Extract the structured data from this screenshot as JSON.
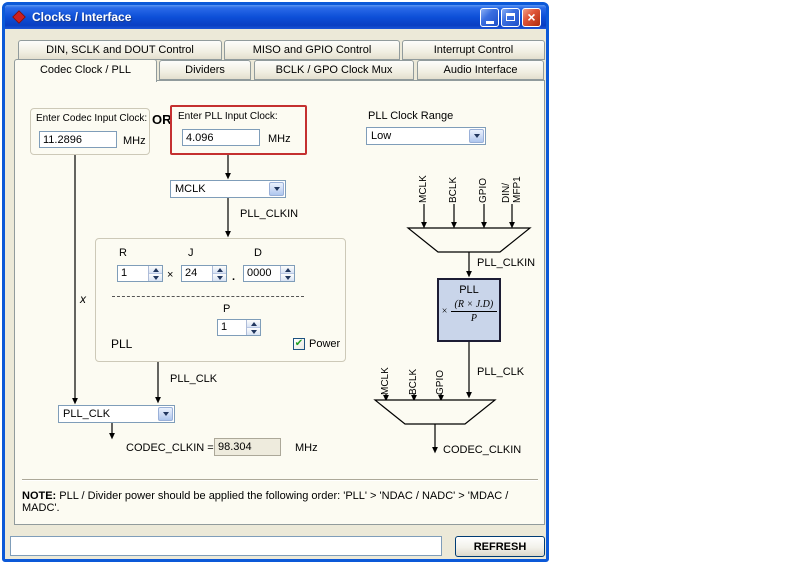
{
  "icons": {
    "close_glyph": "×",
    "check_glyph": "✔"
  },
  "title_bar": {
    "title": "Clocks / Interface"
  },
  "tabs_outer": [
    "DIN, SCLK and DOUT Control",
    "MISO and GPIO Control",
    "Interrupt Control"
  ],
  "tabs_inner": [
    "Codec Clock / PLL",
    "Dividers",
    "BCLK / GPO Clock Mux",
    "Audio Interface"
  ],
  "left": {
    "codec_group_label": "Enter Codec Input Clock:",
    "codec_value": "11.2896",
    "codec_unit": "MHz",
    "or_label": "OR",
    "pll_group_label": "Enter PLL Input Clock:",
    "pll_value": "4.096",
    "pll_unit": "MHz",
    "clkin_mux_value": "MCLK",
    "pll_clkin_arrow_label": "PLL_CLKIN",
    "x_operand": "x",
    "r_label": "R",
    "r_value": "1",
    "times_operand": "×",
    "j_label": "J",
    "j_value": "24",
    "dot_operand": ".",
    "d_label": "D",
    "d_value": "0000",
    "p_label": "P",
    "p_value": "1",
    "pll_caption": "PLL",
    "power_label": "Power",
    "pll_clk_arrow_label": "PLL_CLK",
    "pll_clk_mux_value": "PLL_CLK",
    "codec_clkin_label": "CODEC_CLKIN =",
    "codec_clkin_value": "98.304",
    "codec_clkin_unit": "MHz"
  },
  "right": {
    "range_label": "PLL Clock Range",
    "range_value": "Low",
    "mux1_inputs": [
      "MCLK",
      "BCLK",
      "GPIO",
      "DIN/\nMFP1"
    ],
    "pll_clkin_label": "PLL_CLKIN",
    "pll_box_title": "PLL",
    "formula_times": "×",
    "formula_numerator": "(R × J.D)",
    "formula_denominator": "P",
    "pll_clk_label": "PLL_CLK",
    "mux2_inputs": [
      "MCLK",
      "BCLK",
      "GPIO"
    ],
    "codec_clkin_label": "CODEC_CLKIN"
  },
  "note": {
    "prefix": "NOTE:",
    "body": " PLL / Divider power should be applied the following order: 'PLL' > 'NDAC / NADC' > 'MDAC / MADC'."
  },
  "footer": {
    "input_value": "",
    "refresh_label": "REFRESH"
  }
}
